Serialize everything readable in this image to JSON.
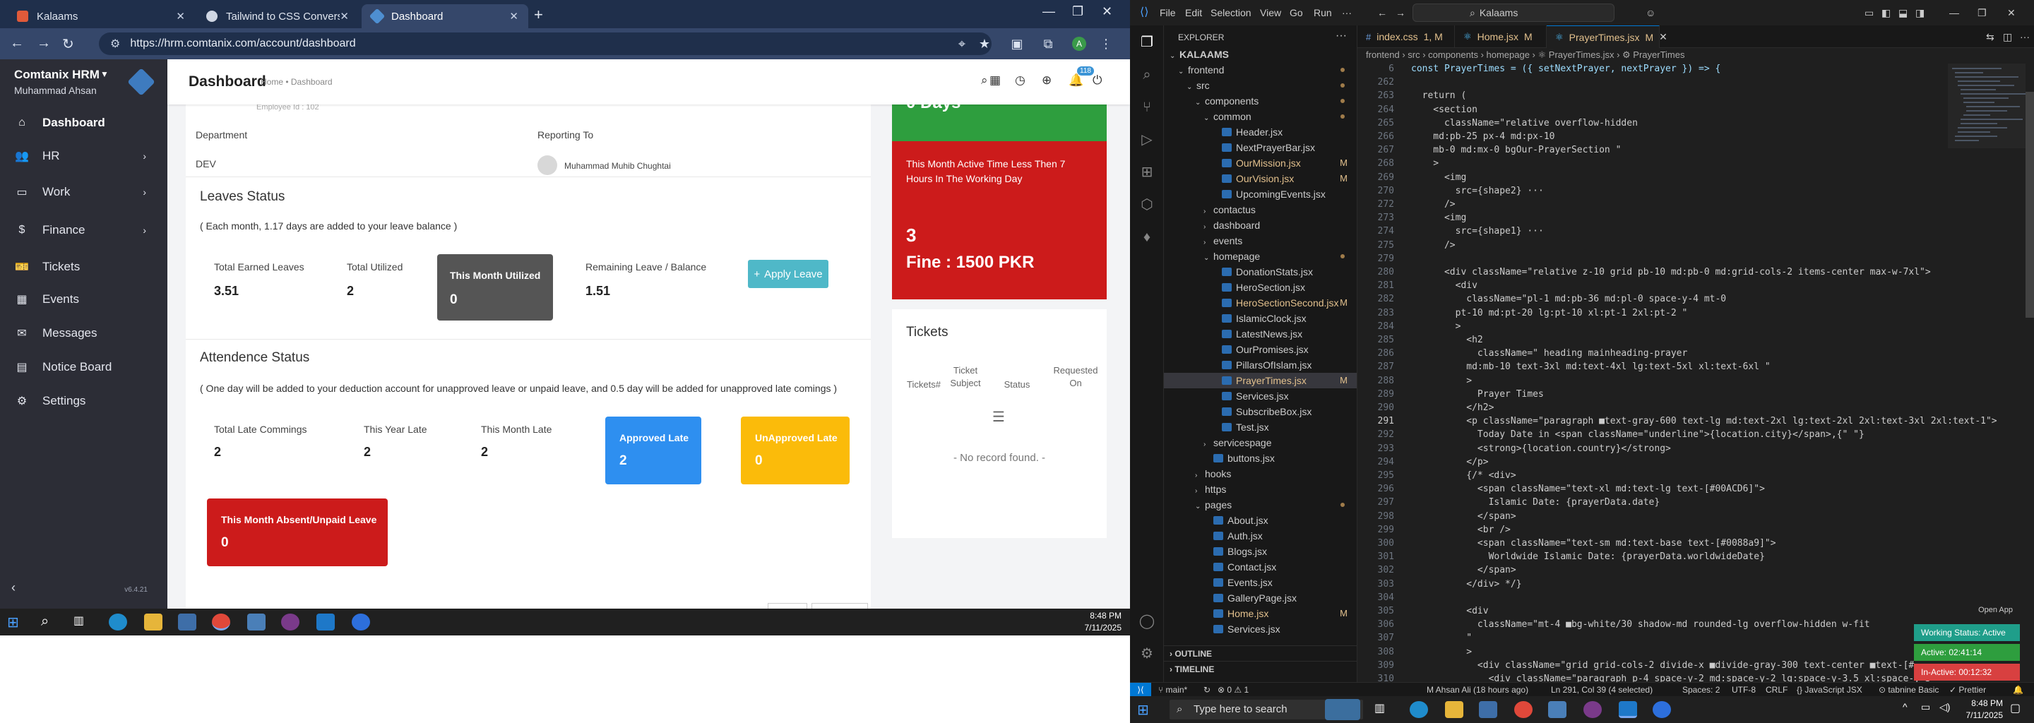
{
  "browser": {
    "tabs": [
      {
        "label": "Kalaams",
        "favicon_color": "#e05a3a"
      },
      {
        "label": "Tailwind to CSS Conversion",
        "favicon_color": "#cfd6e3"
      },
      {
        "label": "Dashboard",
        "favicon_color": "#4e8fd1"
      }
    ],
    "url": "https://hrm.comtanix.com/account/dashboard",
    "notif_count": "118"
  },
  "hrm": {
    "company": "Comtanix HRM",
    "user": "Muhammad Ahsan",
    "version": "v6.4.21",
    "menu": [
      {
        "label": "Dashboard",
        "icon": "home-icon"
      },
      {
        "label": "HR",
        "icon": "users-icon"
      },
      {
        "label": "Work",
        "icon": "briefcase-icon"
      },
      {
        "label": "Finance",
        "icon": "dollar-icon"
      },
      {
        "label": "Tickets",
        "icon": "ticket-icon"
      },
      {
        "label": "Events",
        "icon": "calendar-icon"
      },
      {
        "label": "Messages",
        "icon": "message-icon"
      },
      {
        "label": "Notice Board",
        "icon": "clipboard-icon"
      },
      {
        "label": "Settings",
        "icon": "gear-icon"
      }
    ],
    "header": {
      "title": "Dashboard",
      "breadcrumb": "Home • Dashboard"
    },
    "profile": {
      "dept_label": "Department",
      "dept_value": "DEV",
      "report_label": "Reporting To",
      "report_value": "Muhammad Muhib Chughtai",
      "top_cut_text": "Employee Id : 102"
    },
    "leaves": {
      "title": "Leaves Status",
      "note": "( Each month, 1.17 days are added to your leave balance )",
      "earned_label": "Total Earned Leaves",
      "earned_value": "3.51",
      "utilized_label": "Total Utilized",
      "utilized_value": "2",
      "month_label": "This Month Utilized",
      "month_value": "0",
      "remaining_label": "Remaining Leave / Balance",
      "remaining_value": "1.51",
      "apply_label": "Apply Leave"
    },
    "attendance": {
      "title": "Attendence Status",
      "note": "( One day will be added to your deduction account for unapproved leave or unpaid leave, and 0.5 day will be added for unapproved late comings )",
      "late_label": "Total Late Commings",
      "late_value": "2",
      "year_label": "This Year Late",
      "year_value": "2",
      "month_label": "This Month Late",
      "month_value": "2",
      "approved_label": "Approved Late",
      "approved_value": "2",
      "unapproved_label": "UnApproved Late",
      "unapproved_value": "0",
      "absent_label": "This Month Absent/Unpaid Leave",
      "absent_value": "0"
    },
    "right": {
      "green_value": "0 Days",
      "red_title": "This Month Active Time Less Then 7 Hours In The Working Day",
      "red_value": "3",
      "fine": "Fine : 1500 PKR",
      "tickets_title": "Tickets",
      "cols": [
        "Tickets#",
        "Ticket Subject",
        "Status",
        "Requested On"
      ],
      "empty": "- No record found. -"
    }
  },
  "taskbar_left": {
    "time": "8:48 PM",
    "date": "7/11/2025"
  },
  "vscode": {
    "menu": [
      "File",
      "Edit",
      "Selection",
      "View",
      "Go",
      "Run"
    ],
    "search": "Kalaams",
    "explorer_title": "EXPLORER",
    "tree": [
      {
        "name": "KALAAMS",
        "indent": 0,
        "type": "root"
      },
      {
        "name": "frontend",
        "indent": 1,
        "type": "folder-open",
        "dot": true
      },
      {
        "name": "src",
        "indent": 2,
        "type": "folder-open",
        "dot": true
      },
      {
        "name": "components",
        "indent": 3,
        "type": "folder-open",
        "dot": true
      },
      {
        "name": "common",
        "indent": 4,
        "type": "folder-open",
        "dot": true
      },
      {
        "name": "Header.jsx",
        "indent": 5,
        "type": "file"
      },
      {
        "name": "NextPrayerBar.jsx",
        "indent": 5,
        "type": "file"
      },
      {
        "name": "OurMission.jsx",
        "indent": 5,
        "type": "file",
        "mod": "M"
      },
      {
        "name": "OurVision.jsx",
        "indent": 5,
        "type": "file",
        "mod": "M"
      },
      {
        "name": "UpcomingEvents.jsx",
        "indent": 5,
        "type": "file"
      },
      {
        "name": "contactus",
        "indent": 4,
        "type": "folder"
      },
      {
        "name": "dashboard",
        "indent": 4,
        "type": "folder"
      },
      {
        "name": "events",
        "indent": 4,
        "type": "folder"
      },
      {
        "name": "homepage",
        "indent": 4,
        "type": "folder-open",
        "dot": true
      },
      {
        "name": "DonationStats.jsx",
        "indent": 5,
        "type": "file"
      },
      {
        "name": "HeroSection.jsx",
        "indent": 5,
        "type": "file"
      },
      {
        "name": "HeroSectionSecond.jsx",
        "indent": 5,
        "type": "file",
        "mod": "M"
      },
      {
        "name": "IslamicClock.jsx",
        "indent": 5,
        "type": "file"
      },
      {
        "name": "LatestNews.jsx",
        "indent": 5,
        "type": "file"
      },
      {
        "name": "OurPromises.jsx",
        "indent": 5,
        "type": "file"
      },
      {
        "name": "PillarsOfIslam.jsx",
        "indent": 5,
        "type": "file"
      },
      {
        "name": "PrayerTimes.jsx",
        "indent": 5,
        "type": "file",
        "mod": "M",
        "sel": true
      },
      {
        "name": "Services.jsx",
        "indent": 5,
        "type": "file"
      },
      {
        "name": "SubscribeBox.jsx",
        "indent": 5,
        "type": "file"
      },
      {
        "name": "Test.jsx",
        "indent": 5,
        "type": "file"
      },
      {
        "name": "servicespage",
        "indent": 4,
        "type": "folder"
      },
      {
        "name": "buttons.jsx",
        "indent": 4,
        "type": "file"
      },
      {
        "name": "hooks",
        "indent": 3,
        "type": "folder"
      },
      {
        "name": "https",
        "indent": 3,
        "type": "folder"
      },
      {
        "name": "pages",
        "indent": 3,
        "type": "folder-open",
        "dot": true
      },
      {
        "name": "About.jsx",
        "indent": 4,
        "type": "file"
      },
      {
        "name": "Auth.jsx",
        "indent": 4,
        "type": "file"
      },
      {
        "name": "Blogs.jsx",
        "indent": 4,
        "type": "file"
      },
      {
        "name": "Contact.jsx",
        "indent": 4,
        "type": "file"
      },
      {
        "name": "Events.jsx",
        "indent": 4,
        "type": "file"
      },
      {
        "name": "GalleryPage.jsx",
        "indent": 4,
        "type": "file"
      },
      {
        "name": "Home.jsx",
        "indent": 4,
        "type": "file",
        "mod": "M"
      },
      {
        "name": "Services.jsx",
        "indent": 4,
        "type": "file"
      }
    ],
    "sections": [
      "OUTLINE",
      "TIMELINE"
    ],
    "tabs": [
      {
        "label": "index.css",
        "suffix": "1, M",
        "icon": "#"
      },
      {
        "label": "Home.jsx",
        "suffix": "M",
        "icon": "⚛"
      },
      {
        "label": "PrayerTimes.jsx",
        "suffix": "M",
        "icon": "⚛",
        "active": true
      }
    ],
    "breadcrumb": "frontend › src › components › homepage › ⚛ PrayerTimes.jsx › ⚙ PrayerTimes",
    "code": [
      {
        "n": "6",
        "t": "const PrayerTimes = ({ setNextPrayer, nextPrayer }) => {"
      },
      {
        "n": "262",
        "t": ""
      },
      {
        "n": "263",
        "t": "  return ("
      },
      {
        "n": "264",
        "t": "    <section"
      },
      {
        "n": "265",
        "t": "      className=\"relative overflow-hidden"
      },
      {
        "n": "266",
        "t": "    md:pb-25 px-4 md:px-10"
      },
      {
        "n": "267",
        "t": "    mb-0 md:mx-0 bgOur-PrayerSection \""
      },
      {
        "n": "268",
        "t": "    >"
      },
      {
        "n": "269",
        "t": "      <img"
      },
      {
        "n": "270",
        "t": "        src={shape2} ···"
      },
      {
        "n": "272",
        "t": "      />"
      },
      {
        "n": "273",
        "t": "      <img"
      },
      {
        "n": "274",
        "t": "        src={shape1} ···"
      },
      {
        "n": "275",
        "t": "      />"
      },
      {
        "n": "279",
        "t": ""
      },
      {
        "n": "280",
        "t": "      <div className=\"relative z-10 grid pb-10 md:pb-0 md:grid-cols-2 items-center max-w-7xl\">"
      },
      {
        "n": "281",
        "t": "        <div"
      },
      {
        "n": "282",
        "t": "          className=\"pl-1 md:pb-36 md:pl-0 space-y-4 mt-0"
      },
      {
        "n": "283",
        "t": "        pt-10 md:pt-20 lg:pt-10 xl:pt-1 2xl:pt-2 \""
      },
      {
        "n": "284",
        "t": "        >"
      },
      {
        "n": "285",
        "t": "          <h2"
      },
      {
        "n": "286",
        "t": "            className=\" heading mainheading-prayer"
      },
      {
        "n": "287",
        "t": "          md:mb-10 text-3xl md:text-4xl lg:text-5xl xl:text-6xl \""
      },
      {
        "n": "288",
        "t": "          >"
      },
      {
        "n": "289",
        "t": "            Prayer Times"
      },
      {
        "n": "290",
        "t": "          </h2>"
      },
      {
        "n": "291",
        "t": "          <p className=\"paragraph ■text-gray-600 text-lg md:text-2xl lg:text-2xl 2xl:text-3xl 2xl:text-1\">"
      },
      {
        "n": "292",
        "t": "            Today Date in <span className=\"underline\">{location.city}</span>,{\" \"}"
      },
      {
        "n": "293",
        "t": "            <strong>{location.country}</strong>"
      },
      {
        "n": "294",
        "t": "          </p>"
      },
      {
        "n": "295",
        "t": "          {/* <div>"
      },
      {
        "n": "296",
        "t": "            <span className=\"text-xl md:text-lg text-[#00ACD6]\">"
      },
      {
        "n": "297",
        "t": "              Islamic Date: {prayerData.date}"
      },
      {
        "n": "298",
        "t": "            </span>"
      },
      {
        "n": "299",
        "t": "            <br />"
      },
      {
        "n": "300",
        "t": "            <span className=\"text-sm md:text-base text-[#0088a9]\">"
      },
      {
        "n": "301",
        "t": "              Worldwide Islamic Date: {prayerData.worldwideDate}"
      },
      {
        "n": "302",
        "t": "            </span>"
      },
      {
        "n": "303",
        "t": "          </div> */}"
      },
      {
        "n": "304",
        "t": ""
      },
      {
        "n": "305",
        "t": "          <div"
      },
      {
        "n": "306",
        "t": "            className=\"mt-4 ■bg-white/30 shadow-md rounded-lg overflow-hidden w-fit"
      },
      {
        "n": "307",
        "t": "          \""
      },
      {
        "n": "308",
        "t": "          >"
      },
      {
        "n": "309",
        "t": "            <div className=\"grid grid-cols-2 divide-x ■divide-gray-300 text-center ■text-[#"
      },
      {
        "n": "310",
        "t": "              <div className=\"paragraph p-4 space-y-2 md:space-y-2 lg:space-y-3.5 xl:space-y-3"
      }
    ],
    "status": {
      "branch": "main*",
      "errors": "⊗ 0 ⚠ 1",
      "author": "M Ahsan Ali (18 hours ago)",
      "position": "Ln 291, Col 39 (4 selected)",
      "spaces": "Spaces: 2",
      "encoding": "UTF-8",
      "eol": "CRLF",
      "lang": "{} JavaScript JSX",
      "tabnine": "⊙ tabnine Basic",
      "prettier": "✓ Prettier"
    },
    "open_app": "Open App",
    "working": [
      {
        "label": "Working Status: Active",
        "color": "#1f9e8a"
      },
      {
        "label": "Active: 02:41:14",
        "color": "#2e9e3e"
      },
      {
        "label": "In-Active: 00:12:32",
        "color": "#d84040"
      }
    ]
  },
  "taskbar_right": {
    "search": "Type here to search",
    "time": "8:48 PM",
    "date": "7/11/2025"
  }
}
